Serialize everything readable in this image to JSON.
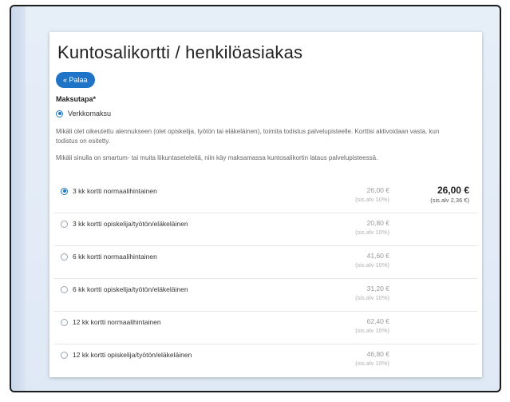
{
  "page": {
    "title": "Kuntosalikortti / henkilöasiakas",
    "back_label": "« Palaa",
    "payment_label": "Maksutapa*",
    "payment_option": "Verkkomaksu",
    "info_text_1": "Mikäli olet oikeutettu alennukseen (olet opiskelija, työtön tai eläkeläinen), toimita todistus palvelupisteelle. Korttisi aktivoidaan vasta, kun todistus on esitetty.",
    "info_text_2": "Mikäli sinulla on smartum- tai muita liikuntaseteleitä, niin käy maksamassa kuntosalikortin lataus palvelupisteessä."
  },
  "products": [
    {
      "name": "3 kk kortti normaalihintainen",
      "price": "26,00 €",
      "vat": "(sis.alv 10%)",
      "selected": true,
      "total": "26,00 €",
      "total_vat": "(sis.alv 2,36 €)"
    },
    {
      "name": "3 kk kortti opiskelija/työtön/eläkeläinen",
      "price": "20,80 €",
      "vat": "(sis.alv 10%)",
      "selected": false,
      "total": "",
      "total_vat": ""
    },
    {
      "name": "6 kk kortti normaalihintainen",
      "price": "41,60 €",
      "vat": "(sis.alv 10%)",
      "selected": false,
      "total": "",
      "total_vat": ""
    },
    {
      "name": "6 kk kortti opiskelija/työtön/eläkeläinen",
      "price": "31,20 €",
      "vat": "(sis.alv 10%)",
      "selected": false,
      "total": "",
      "total_vat": ""
    },
    {
      "name": "12 kk kortti normaalihintainen",
      "price": "62,40 €",
      "vat": "(sis.alv 10%)",
      "selected": false,
      "total": "",
      "total_vat": ""
    },
    {
      "name": "12 kk kortti opiskelija/työtön/eläkeläinen",
      "price": "46,80 €",
      "vat": "(sis.alv 10%)",
      "selected": false,
      "total": "",
      "total_vat": ""
    }
  ],
  "colors": {
    "accent": "#1f74c8",
    "frame_bg": "#e6eef8"
  }
}
